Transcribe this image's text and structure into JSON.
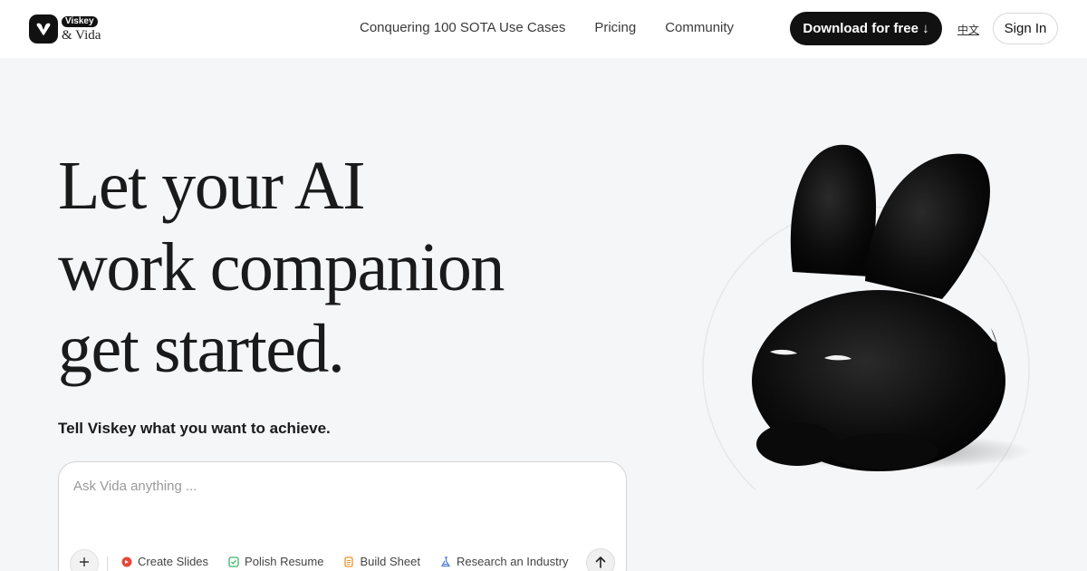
{
  "brand": {
    "badge": "Viskey",
    "name": "& Vida"
  },
  "nav": {
    "items": [
      {
        "label": "Conquering 100 SOTA Use Cases"
      },
      {
        "label": "Pricing"
      },
      {
        "label": "Community"
      }
    ]
  },
  "header": {
    "download_label": "Download for free ↓",
    "lang_label": "中文",
    "signin_label": "Sign In"
  },
  "hero": {
    "title_lines": [
      "Let your AI",
      "work companion",
      "get started."
    ],
    "subtitle": "Tell Viskey what you want to achieve."
  },
  "chat": {
    "placeholder": "Ask Vida anything ...",
    "chips": [
      {
        "label": "Create Slides",
        "icon": "slides-icon",
        "color": "#e8473a"
      },
      {
        "label": "Polish Resume",
        "icon": "resume-icon",
        "color": "#3fb56b"
      },
      {
        "label": "Build Sheet",
        "icon": "sheet-icon",
        "color": "#f0932b"
      },
      {
        "label": "Research an Industry",
        "icon": "research-icon",
        "color": "#4a7bd8"
      }
    ]
  },
  "colors": {
    "accent": "#111111",
    "background": "#f5f6f8"
  }
}
